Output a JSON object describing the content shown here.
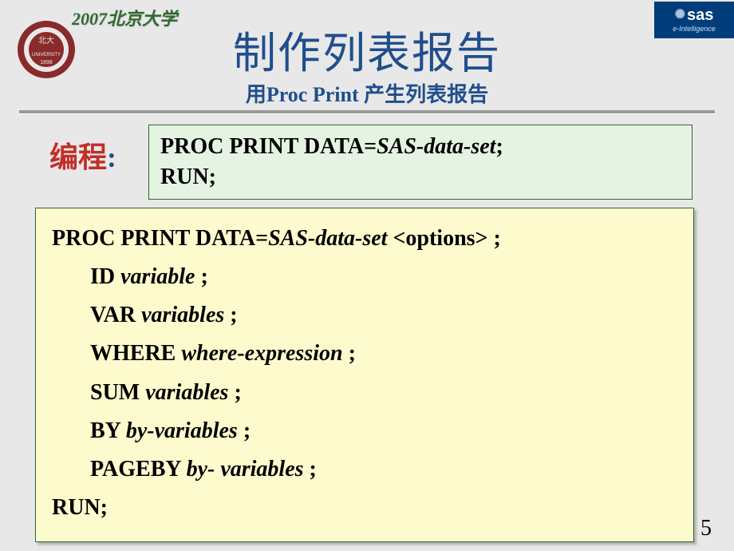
{
  "header": {
    "top_label": "2007北京大学",
    "title": "制作列表报告",
    "subtitle_pre": "用",
    "subtitle_en": "Proc Print ",
    "subtitle_post": "产生列表报告",
    "sas_text": "sas",
    "sas_tag": "e-Intelligence"
  },
  "section_label": "编程",
  "colon": ":",
  "box1": {
    "line1_a": "PROC PRINT DATA=",
    "line1_b": "SAS-data-set",
    "line1_c": ";",
    "line2": "RUN;"
  },
  "box2": {
    "l1_a": "PROC PRINT  DATA=",
    "l1_b": "SAS-data-set",
    "l1_c": "  <options> ;",
    "l2_a": "ID  ",
    "l2_b": "variable ",
    "l2_c": ";",
    "l3_a": "VAR  ",
    "l3_b": "variables ",
    "l3_c": ";",
    "l4_a": "WHERE  ",
    "l4_b": "where-expression ",
    "l4_c": ";",
    "l5_a": "SUM  ",
    "l5_b": "variables ",
    "l5_c": ";",
    "l6_a": "BY  ",
    "l6_b": "by-variables ",
    "l6_c": ";",
    "l7_a": "PAGEBY  ",
    "l7_b": "by- variables ",
    "l7_c": ";",
    "l8": "RUN;"
  },
  "page_number": "5"
}
